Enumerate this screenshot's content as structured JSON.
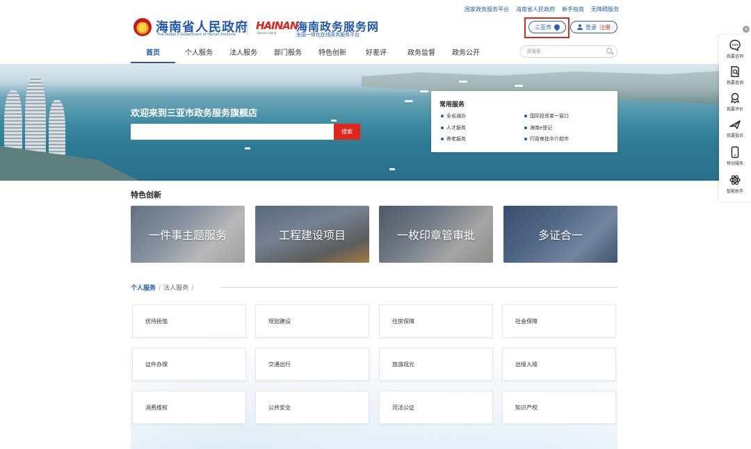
{
  "top_links": [
    "国家政务服务平台",
    "海南省人民政府",
    "新手指南",
    "无障碍服务"
  ],
  "header": {
    "gov_name": "海南省人民政府",
    "gov_name_en": "The People's Government of Hainan Province",
    "hainan_logo_text": "HAINAN",
    "hainan_logo_sub": "Hainan Island",
    "service_name": "海南政务服务网",
    "service_sub": "全国一体化在线政务服务平台",
    "city": "三亚市",
    "login": "登录",
    "register": "注册"
  },
  "nav": {
    "items": [
      "首页",
      "个人服务",
      "法人服务",
      "部门服务",
      "特色创新",
      "好差评",
      "政务监督",
      "政务公开"
    ],
    "active_index": 0,
    "search_placeholder": "请搜索"
  },
  "banner": {
    "welcome": "欢迎来到三亚市政务服务旗舰店",
    "search_button": "搜索",
    "common_title": "常用服务",
    "common_items": [
      "全省通办",
      "国际投资单一窗口",
      "人才服务",
      "海南e登记",
      "养老服务",
      "行政审批中介超市"
    ]
  },
  "features": {
    "title": "特色创新",
    "cards": [
      "一件事主题服务",
      "工程建设项目",
      "一枚印章管审批",
      "多证合一"
    ]
  },
  "services": {
    "tab_active": "个人服务",
    "tab_other": "法人服务",
    "separator": "/",
    "items": [
      "优待抚恤",
      "规划建设",
      "住房保障",
      "社会保障",
      "证件办理",
      "交通出行",
      "旅游观光",
      "出境入境",
      "消费维权",
      "公共安全",
      "司法公证",
      "知识产权"
    ]
  },
  "sidebar": {
    "close": "×",
    "items": [
      "我要咨询",
      "我要查询",
      "我要评价",
      "我要投诉",
      "移动服务",
      "智能助手"
    ]
  },
  "colors": {
    "brand_blue": "#1e58b4",
    "accent_red": "#e1251b",
    "link_blue": "#2a5db0"
  }
}
